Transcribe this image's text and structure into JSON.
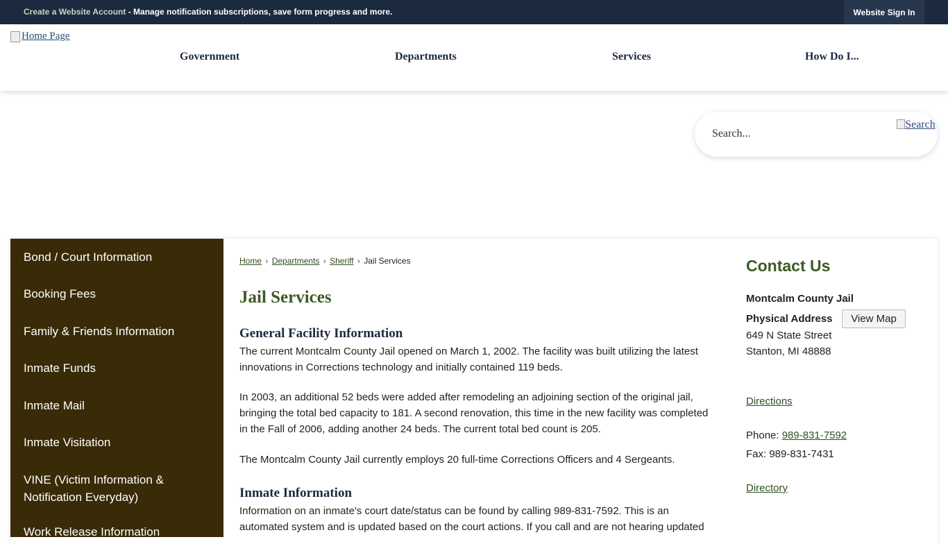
{
  "topbar": {
    "account_link": "Create a Website Account",
    "account_message": " - Manage notification subscriptions, save form progress and more.",
    "sign_in": "Website Sign In"
  },
  "header": {
    "logo_alt": "Home Page",
    "nav": [
      "Government",
      "Departments",
      "Services",
      "How Do I..."
    ]
  },
  "search": {
    "placeholder": "Search...",
    "button_alt": "Search"
  },
  "sidebar": {
    "items": [
      "Bond / Court Information",
      "Booking Fees",
      "Family & Friends Information",
      "Inmate Funds",
      "Inmate Mail",
      "Inmate Visitation",
      "VINE (Victim Information & Notification Everyday)",
      "Work Release Information"
    ]
  },
  "breadcrumb": {
    "items": [
      "Home",
      "Departments",
      "Sheriff"
    ],
    "current": "Jail Services",
    "separator": "›"
  },
  "main": {
    "title": "Jail Services",
    "section1_heading": "General Facility Information",
    "para1": "The current Montcalm County Jail opened on March 1, 2002. The facility was built utilizing the latest innovations in Corrections technology and initially contained 119 beds.",
    "para2": "In 2003, an additional 52 beds were added after remodeling an adjoining section of the original jail, bringing the total bed capacity to 181. A second renovation, this time in the new facility was completed in the Fall of 2006, adding another 24 beds. The current total bed count is 205.",
    "para3": "The Montcalm County Jail currently employs 20 full-time Corrections Officers and 4 Sergeants.",
    "section2_heading": "Inmate Information",
    "para4": "Information on an inmate's court date/status can be found by calling 989-831-7592. This is an automated system and is updated based on the court actions. If you call and are not hearing updated"
  },
  "contact": {
    "title": "Contact Us",
    "name": "Montcalm County Jail",
    "address_label": "Physical Address",
    "view_map": "View Map",
    "street": "649 N State Street",
    "city": "Stanton, MI 48888",
    "directions": "Directions",
    "phone_label": "Phone: ",
    "phone": "989-831-7592",
    "fax": "Fax: 989-831-7431",
    "directory": "Directory"
  },
  "colors": {
    "topbar": "#1b2a3f",
    "sidebar": "#392b07",
    "heading_green": "#3d5a26",
    "heading_navy": "#1b2a3f"
  }
}
